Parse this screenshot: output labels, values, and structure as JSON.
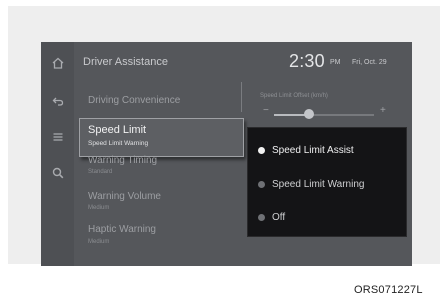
{
  "header": {
    "title": "Driver Assistance",
    "time": "2:30",
    "ampm": "PM",
    "date": "Fri, Oct. 29"
  },
  "sidebar": {
    "icons": [
      "home-icon",
      "back-icon",
      "menu-icon",
      "search-icon"
    ]
  },
  "menu": {
    "items": [
      {
        "label": "Driving Convenience",
        "sub": ""
      },
      {
        "label": "Speed Limit",
        "sub": "Speed Limit Warning"
      },
      {
        "label": "Warning Timing",
        "sub": "Standard"
      },
      {
        "label": "Warning Volume",
        "sub": "Medium"
      },
      {
        "label": "Haptic Warning",
        "sub": "Medium"
      }
    ]
  },
  "offset": {
    "label": "Speed Limit Offset (km/h)",
    "minus": "−",
    "plus": "+",
    "level": 0.35
  },
  "popup": {
    "options": [
      {
        "label": "Speed Limit Assist",
        "selected": true
      },
      {
        "label": "Speed Limit Warning",
        "selected": false
      },
      {
        "label": "Off",
        "selected": false
      }
    ]
  },
  "caption": "ORS071227L",
  "colors": {
    "screen_bg": "#55575b",
    "popup_bg": "#141416",
    "text_light": "#f0f0f1"
  }
}
